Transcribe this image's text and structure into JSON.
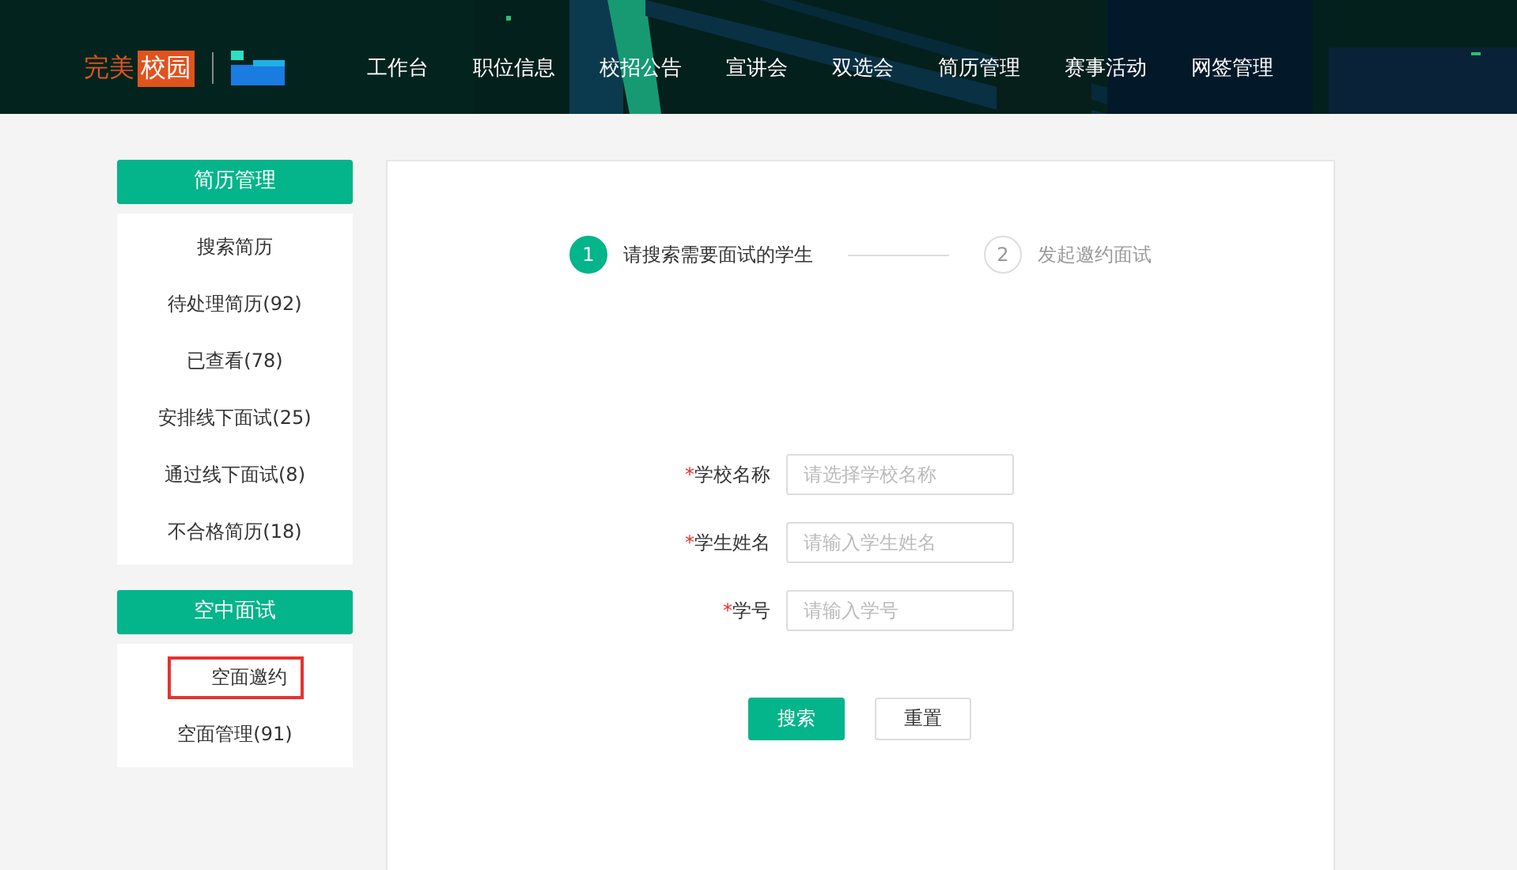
{
  "header": {
    "logo": {
      "part1": "完美",
      "part2": "校园"
    },
    "nav": [
      {
        "label": "工作台"
      },
      {
        "label": "职位信息"
      },
      {
        "label": "校招公告"
      },
      {
        "label": "宣讲会"
      },
      {
        "label": "双选会"
      },
      {
        "label": "简历管理"
      },
      {
        "label": "赛事活动"
      },
      {
        "label": "网签管理"
      }
    ]
  },
  "sidebar": [
    {
      "title": "简历管理",
      "items": [
        {
          "label": "搜索简历",
          "highlighted": false
        },
        {
          "label": "待处理简历(92)",
          "highlighted": false
        },
        {
          "label": "已查看(78)",
          "highlighted": false
        },
        {
          "label": "安排线下面试(25)",
          "highlighted": false
        },
        {
          "label": "通过线下面试(8)",
          "highlighted": false
        },
        {
          "label": "不合格简历(18)",
          "highlighted": false
        }
      ]
    },
    {
      "title": "空中面试",
      "items": [
        {
          "label": "空面邀约",
          "highlighted": true
        },
        {
          "label": "空面管理(91)",
          "highlighted": false
        }
      ]
    }
  ],
  "steps": [
    {
      "number": "1",
      "label": "请搜索需要面试的学生",
      "selected": true
    },
    {
      "number": "2",
      "label": "发起邀约面试",
      "selected": false
    }
  ],
  "form": [
    {
      "required_mark": "*",
      "label": "学校名称",
      "placeholder": "请选择学校名称"
    },
    {
      "required_mark": "*",
      "label": "学生姓名",
      "placeholder": "请输入学生姓名"
    },
    {
      "required_mark": "*",
      "label": "学号",
      "placeholder": "请输入学号"
    }
  ],
  "buttons": [
    {
      "label": "搜索",
      "kind": "primary"
    },
    {
      "label": "重置",
      "kind": "secondary"
    }
  ]
}
